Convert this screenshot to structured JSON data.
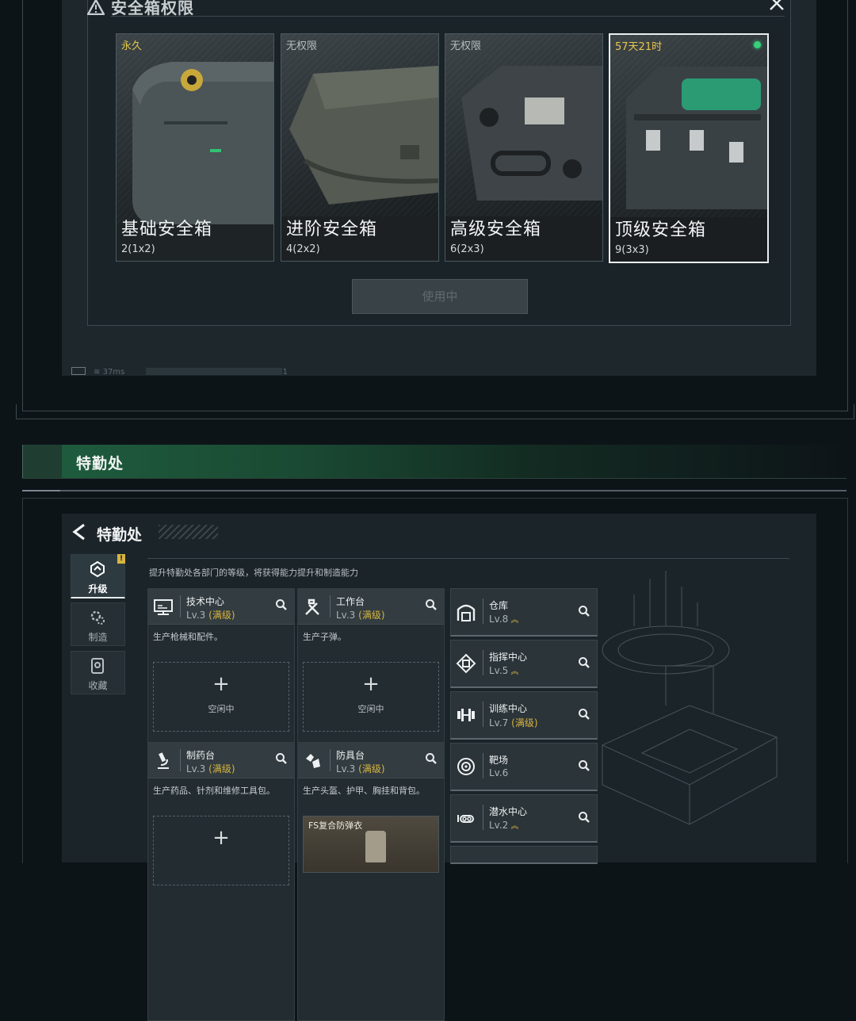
{
  "dialog": {
    "title": "安全箱权限",
    "use_button": "使用中",
    "boxes": [
      {
        "status": "永久",
        "name": "基础安全箱",
        "size": "2(1x2)"
      },
      {
        "status": "无权限",
        "name": "进阶安全箱",
        "size": "4(2x2)"
      },
      {
        "status": "无权限",
        "name": "高级安全箱",
        "size": "6(2x3)"
      },
      {
        "status": "57天21时",
        "name": "顶级安全箱",
        "size": "9(3x3)"
      }
    ]
  },
  "status_bar": {
    "ping": "37ms",
    "page_marker": "1"
  },
  "section": {
    "title": "特勤处"
  },
  "page": {
    "title": "特勤处",
    "subtitle": "提升特勤处各部门的等级，将获得能力提升和制造能力"
  },
  "side_tabs": [
    {
      "label": "升级",
      "badge": "!"
    },
    {
      "label": "制造"
    },
    {
      "label": "收藏"
    }
  ],
  "stations": [
    {
      "name": "技术中心",
      "lv": "Lv.3",
      "max": "(满级)",
      "desc": "生产枪械和配件。",
      "slot": "空闲中"
    },
    {
      "name": "工作台",
      "lv": "Lv.3",
      "max": "(满级)",
      "desc": "生产子弹。",
      "slot": "空闲中"
    },
    {
      "name": "制药台",
      "lv": "Lv.3",
      "max": "(满级)",
      "desc": "生产药品、针剂和维修工具包。",
      "slot": ""
    },
    {
      "name": "防具台",
      "lv": "Lv.3",
      "max": "(满级)",
      "desc": "生产头盔、护甲、胸挂和背包。",
      "item": "FS复合防弹衣"
    }
  ],
  "facilities": [
    {
      "name": "仓库",
      "lv": "Lv.8",
      "max": "",
      "upgradable": true
    },
    {
      "name": "指挥中心",
      "lv": "Lv.5",
      "max": "",
      "upgradable": true
    },
    {
      "name": "训练中心",
      "lv": "Lv.7",
      "max": "(满级)",
      "upgradable": false
    },
    {
      "name": "靶场",
      "lv": "Lv.6",
      "max": "",
      "upgradable": false
    },
    {
      "name": "潜水中心",
      "lv": "Lv.2",
      "max": "",
      "upgradable": true
    }
  ],
  "colors": {
    "accent_gold": "#d8b540",
    "active_green": "#36d17a",
    "header_green": "#1e5b3d"
  }
}
